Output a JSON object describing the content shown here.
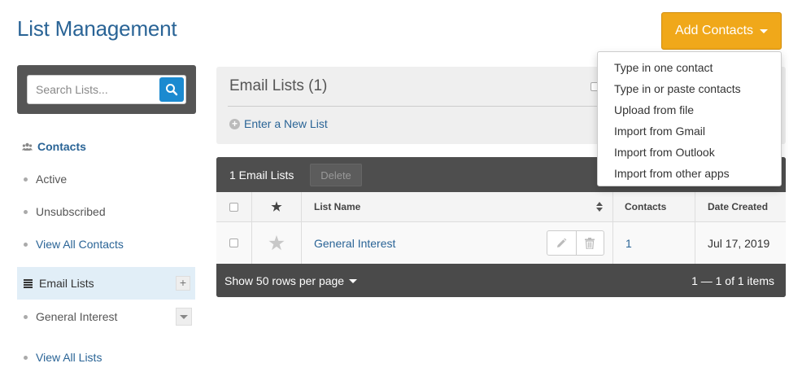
{
  "header": {
    "title": "List Management",
    "add_contacts_label": "Add Contacts"
  },
  "add_menu": {
    "items": [
      "Type in one contact",
      "Type in or paste contacts",
      "Upload from file",
      "Import from Gmail",
      "Import from Outlook",
      "Import from other apps"
    ]
  },
  "sidebar": {
    "search_placeholder": "Search Lists...",
    "contacts_heading": "Contacts",
    "contacts_items": [
      "Active",
      "Unsubscribed"
    ],
    "view_all_contacts": "View All Contacts",
    "email_lists_label": "Email Lists",
    "email_lists_add": "+",
    "lists": [
      "General Interest"
    ],
    "view_all_lists": "View All Lists"
  },
  "panel": {
    "title": "Email Lists (1)",
    "new_list_label": "Enter a New List"
  },
  "table": {
    "toolbar_count": "1 Email Lists",
    "delete_label": "Delete",
    "columns": {
      "star": "★",
      "name": "List Name",
      "contacts": "Contacts",
      "date": "Date Created"
    },
    "rows": [
      {
        "name": "General Interest",
        "contacts": "1",
        "date": "Jul 17, 2019"
      }
    ],
    "rows_per_page": "Show 50 rows per page",
    "pager": "1 — 1 of 1 items"
  },
  "colors": {
    "accent": "#f0a81a",
    "link": "#2a6496",
    "search_button": "#1b8ad0",
    "dark_panel": "#4a4a4a"
  }
}
